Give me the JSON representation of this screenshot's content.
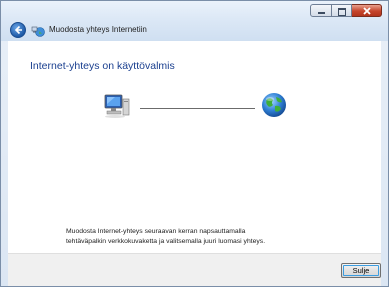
{
  "window": {
    "title": "Muodosta yhteys Internetiin",
    "icons": {
      "back": "back-arrow-icon",
      "app": "network-globe-icon"
    },
    "caption_buttons": [
      "minimize",
      "maximize",
      "close"
    ]
  },
  "main": {
    "heading": "Internet-yhteys on käyttövalmis",
    "diagram": {
      "left_icon": "computer-icon",
      "right_icon": "globe-icon"
    },
    "description_line1": "Muodosta Internet-yhteys seuraavan kerran napsauttamalla",
    "description_line2": "tehtäväpalkin verkkokuvaketta ja valitsemalla juuri luomasi yhteys."
  },
  "footer": {
    "close_label": "Sulje"
  },
  "colors": {
    "heading": "#1a3f8f",
    "accent": "#3c9de0",
    "close_btn": "#c6452c"
  }
}
